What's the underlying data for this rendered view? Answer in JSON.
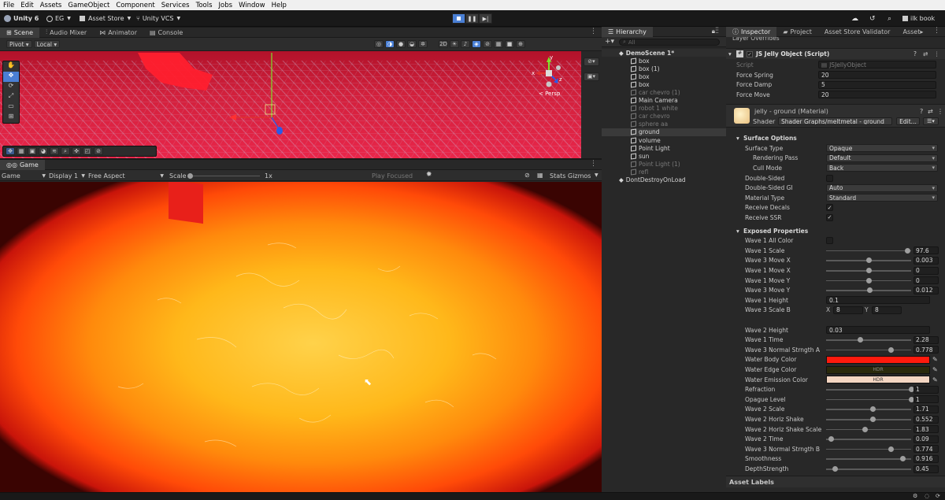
{
  "menu": [
    "File",
    "Edit",
    "Assets",
    "GameObject",
    "Component",
    "Services",
    "Tools",
    "Jobs",
    "Window",
    "Help"
  ],
  "toolbar": {
    "unity_version": "Unity 6",
    "account": "EG",
    "asset_store": "Asset Store",
    "vcs": "Unity VCS",
    "user": "ilk book"
  },
  "scene_panel": {
    "tabs": [
      "Scene",
      "Audio Mixer",
      "Animator",
      "Console"
    ],
    "pivot": "Pivot",
    "space": "Local",
    "persp_label": "< Persp",
    "gizmo_x": "x",
    "gizmo_y": "y",
    "gizmo_z": "z"
  },
  "game_panel": {
    "tab": "Game",
    "mode": "Game",
    "display": "Display 1",
    "aspect": "Free Aspect",
    "scale_label": "Scale",
    "scale_value": "1x",
    "play_focused": "Play Focused",
    "stats": "Stats",
    "gizmos": "Gizmos"
  },
  "hierarchy": {
    "tab": "Hierarchy",
    "search_placeholder": "All",
    "scene_name": "DemoScene 1*",
    "items": [
      {
        "label": "box",
        "dim": false,
        "selected": false
      },
      {
        "label": "box (1)",
        "dim": false,
        "selected": false
      },
      {
        "label": "box",
        "dim": false,
        "selected": false
      },
      {
        "label": "box",
        "dim": false,
        "selected": false
      },
      {
        "label": "car chevro (1)",
        "dim": true,
        "selected": false
      },
      {
        "label": "Main Camera",
        "dim": false,
        "selected": false
      },
      {
        "label": "robot 1 white",
        "dim": true,
        "selected": false
      },
      {
        "label": "car chevro",
        "dim": true,
        "selected": false
      },
      {
        "label": "sphere aa",
        "dim": true,
        "selected": false
      },
      {
        "label": "ground",
        "dim": false,
        "selected": true
      },
      {
        "label": "volume",
        "dim": false,
        "selected": false
      },
      {
        "label": "Point Light",
        "dim": false,
        "selected": false
      },
      {
        "label": "sun",
        "dim": false,
        "selected": false
      },
      {
        "label": "Point Light (1)",
        "dim": true,
        "selected": false
      },
      {
        "label": "refl",
        "dim": true,
        "selected": false
      }
    ],
    "dont_destroy": "DontDestroyOnLoad"
  },
  "inspector": {
    "tabs": [
      "Inspector",
      "Project",
      "Asset Store Validator",
      "Asset"
    ],
    "layer_overrides": "Layer Overrides",
    "component_title": "JS Jelly Object (Script)",
    "script_label": "Script",
    "script_value": "JSJellyObject",
    "fields": [
      {
        "label": "Force Spring",
        "value": "20"
      },
      {
        "label": "Force Damp",
        "value": "5"
      },
      {
        "label": "Force Move",
        "value": "20"
      }
    ],
    "material_title": "jelly - ground (Material)",
    "shader_label": "Shader",
    "shader_value": "Shader Graphs/meltmetal - ground",
    "edit_label": "Edit...",
    "surface_options_title": "Surface Options",
    "surface": [
      {
        "label": "Surface Type",
        "kind": "drop",
        "value": "Opaque",
        "indent": false
      },
      {
        "label": "Rendering Pass",
        "kind": "drop",
        "value": "Default",
        "indent": true
      },
      {
        "label": "Cull Mode",
        "kind": "drop",
        "value": "Back",
        "indent": true
      },
      {
        "label": "Double-Sided",
        "kind": "check",
        "value": "",
        "indent": false
      },
      {
        "label": "Double-Sided GI",
        "kind": "drop",
        "value": "Auto",
        "indent": false
      },
      {
        "label": "Material Type",
        "kind": "drop",
        "value": "Standard",
        "indent": false
      },
      {
        "label": "Receive Decals",
        "kind": "check",
        "value": "✓",
        "indent": false
      },
      {
        "label": "Receive SSR",
        "kind": "check",
        "value": "✓",
        "indent": false
      }
    ],
    "exposed_title": "Exposed Properties",
    "exposed": [
      {
        "label": "Wave 1 All Color",
        "kind": "check",
        "value": "",
        "pos": 0
      },
      {
        "label": "Wave 1 Scale",
        "kind": "slider",
        "value": "97.6",
        "pos": 0.96
      },
      {
        "label": "Wave 3 Move X",
        "kind": "slider",
        "value": "0.003",
        "pos": 0.5
      },
      {
        "label": "Wave 1 Move X",
        "kind": "slider",
        "value": "0",
        "pos": 0.5
      },
      {
        "label": "Wave 1 Move Y",
        "kind": "slider",
        "value": "0",
        "pos": 0.5
      },
      {
        "label": "Wave 3 Move Y",
        "kind": "slider",
        "value": "0.012",
        "pos": 0.51
      },
      {
        "label": "Wave 1 Height",
        "kind": "text",
        "value": "0.1",
        "pos": 0
      },
      {
        "label": "Wave 3 Scale B",
        "kind": "xy",
        "value": "8",
        "value2": "8",
        "pos": 0
      },
      {
        "label": "",
        "kind": "blank",
        "value": "",
        "pos": 0
      },
      {
        "label": "Wave 2 Height",
        "kind": "text",
        "value": "0.03",
        "pos": 0
      },
      {
        "label": "Wave 1 Time",
        "kind": "slider",
        "value": "2.28",
        "pos": 0.4
      },
      {
        "label": "Wave 3 Normal Strngth A",
        "kind": "slider",
        "value": "0.778",
        "pos": 0.76
      },
      {
        "label": "Water Body Color",
        "kind": "color",
        "value": "",
        "color": "#ff1a0d",
        "pos": 0
      },
      {
        "label": "Water Edge Color",
        "kind": "color",
        "value": "HDR",
        "color": "#2a2a0c",
        "pos": 0
      },
      {
        "label": "Water Emission Color",
        "kind": "color",
        "value": "HDR",
        "color": "#f4d6c2",
        "pos": 0
      },
      {
        "label": "Refraction",
        "kind": "slider",
        "value": "1",
        "pos": 1
      },
      {
        "label": "Opague Level",
        "kind": "slider",
        "value": "1",
        "pos": 1
      },
      {
        "label": "Wave 2 Scale",
        "kind": "slider",
        "value": "1.71",
        "pos": 0.55
      },
      {
        "label": "Wave 2 Horiz Shake",
        "kind": "slider",
        "value": "0.552",
        "pos": 0.55
      },
      {
        "label": "Wave 2 Horiz Shake Scale",
        "kind": "slider",
        "value": "1.83",
        "pos": 0.46
      },
      {
        "label": "Wave 2 Time",
        "kind": "slider",
        "value": "0.09",
        "pos": 0.06
      },
      {
        "label": "Wave 3 Normal Strngth B",
        "kind": "slider",
        "value": "0.774",
        "pos": 0.76
      },
      {
        "label": "Smoothness",
        "kind": "slider",
        "value": "0.916",
        "pos": 0.9
      },
      {
        "label": "DepthStrength",
        "kind": "slider",
        "value": "0.45",
        "pos": 0.11
      }
    ],
    "asset_labels": "Asset Labels"
  },
  "colors": {
    "accent": "#4a7fd4",
    "scene_floor": "#d8203a",
    "game_center": "#ffc41a",
    "game_edge": "#ff3a08"
  }
}
